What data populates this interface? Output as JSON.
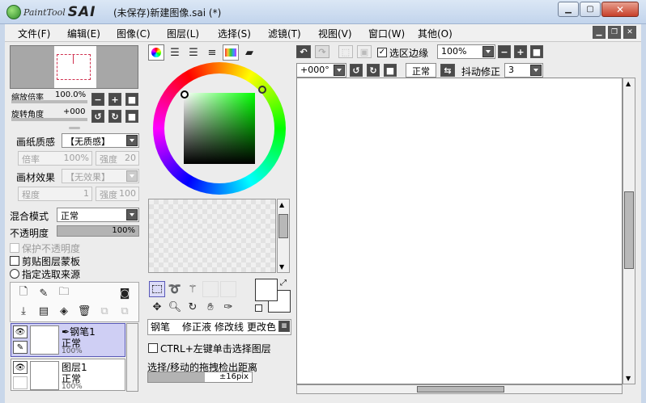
{
  "window": {
    "logo_small": "PaintTool",
    "logo_big": "SAI",
    "title": "(未保存)新建图像.sai (*)"
  },
  "menu": [
    "文件(F)",
    "编辑(E)",
    "图像(C)",
    "图层(L)",
    "选择(S)",
    "滤镜(T)",
    "视图(V)",
    "窗口(W)",
    "其他(O)"
  ],
  "navigator": {
    "zoom_label": "缩放倍率",
    "zoom_value": "100.0%",
    "rotate_label": "旋转角度",
    "rotate_value": "+000"
  },
  "paper": {
    "texture_label": "画纸质感",
    "texture_value": "【无质感】",
    "scale_label": "倍率",
    "scale_value": "100%",
    "strength_label": "强度",
    "strength_value": "20",
    "effect_label": "画材效果",
    "effect_value": "【无效果】",
    "degree_label": "程度",
    "degree_value": "1",
    "effect_strength_label": "强度",
    "effect_strength_value": "100"
  },
  "blend": {
    "mode_label": "混合模式",
    "mode_value": "正常",
    "opacity_label": "不透明度",
    "opacity_value": "100%",
    "opacity_fraction": 1.0,
    "preserve_opacity": "保护不透明度",
    "clip_mask": "剪贴图层蒙板",
    "selection_source": "指定选取来源"
  },
  "layers": [
    {
      "name": "钢笔1",
      "mode": "正常",
      "opacity": "100%",
      "selected": true
    },
    {
      "name": "图层1",
      "mode": "正常",
      "opacity": "100%",
      "selected": false
    }
  ],
  "tools": {
    "tabs": [
      "钢笔",
      "修正液",
      "修改线",
      "更改色"
    ],
    "ctrl_select": "CTRL+左键单击选择图层",
    "drag_label": "选择/移动的拖拽检出距离",
    "drag_value": "±16pix"
  },
  "canvas_toolbar": {
    "selection_edge": "选区边缘",
    "zoom": "100%",
    "angle": "+000°",
    "mode": "正常",
    "stabilizer_label": "抖动修正",
    "stabilizer_value": "3"
  },
  "colors": {
    "accent": "#5959b8",
    "selected_layer": "#cfcff4",
    "nav_rect": "#d0314f",
    "primary_color": "#ffffff",
    "secondary_color": "#ffffff"
  }
}
